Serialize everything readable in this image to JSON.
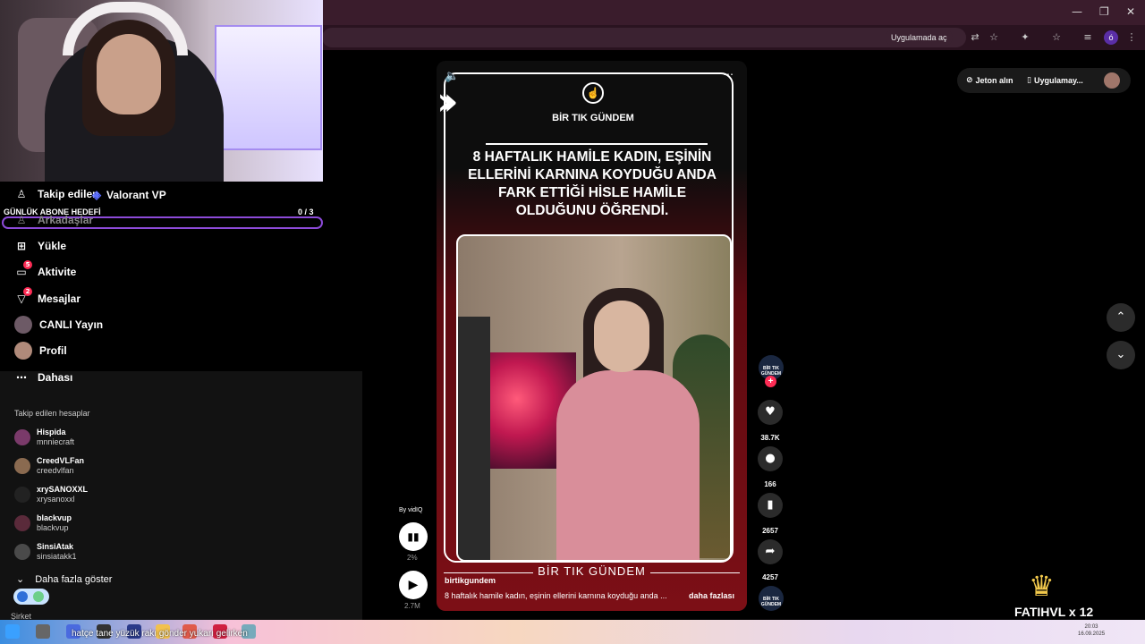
{
  "browser": {
    "open_in_app": "Uygulamada aç",
    "profile_badge": "ó",
    "window_controls": [
      "—",
      "❐",
      "✕"
    ]
  },
  "stream_overlay": {
    "goal_title": "GÜNLÜK ABONE HEDEFİ",
    "goal_count": "0 / 3",
    "game": "Valorant VP",
    "ticker": "hatçe tane yüzük rakı gönder yukarı gelirken",
    "crown_badge": "FATIHVL x 12"
  },
  "sidebar": {
    "items": [
      {
        "label": "Takip edilen",
        "icon": "person-icon"
      },
      {
        "label": "Arkadaşlar",
        "icon": "friends-icon"
      },
      {
        "label": "Yükle",
        "icon": "upload-icon"
      },
      {
        "label": "Aktivite",
        "icon": "activity-icon",
        "badge": "5"
      },
      {
        "label": "Mesajlar",
        "icon": "messages-icon",
        "badge": "2"
      },
      {
        "label": "CANLI Yayın",
        "icon": "live-icon"
      },
      {
        "label": "Profil",
        "icon": "profile-icon"
      },
      {
        "label": "Dahası",
        "icon": "more-icon"
      }
    ],
    "followed_title": "Takip edilen hesaplar",
    "followed": [
      {
        "name": "Hispida",
        "handle": "mnniecraft"
      },
      {
        "name": "CreedVLFan",
        "handle": "creedvlfan"
      },
      {
        "name": "xrySANOXXL",
        "handle": "xrysanoxxl"
      },
      {
        "name": "blackvup",
        "handle": "blackvup"
      },
      {
        "name": "SinsiAtak",
        "handle": "sinsiatakk1"
      }
    ],
    "show_more": "Daha fazla göster",
    "company": "Şirket"
  },
  "video": {
    "brand": "BİR TIK GÜNDEM",
    "headline": "8 HAFTALIK HAMİLE KADIN, EŞİNİN ELLERİNİ KARNINA KOYDUĞU ANDA FARK ETTİĞİ HİSLE HAMİLE OLDUĞUNU ÖĞRENDİ.",
    "footer_brand": "BİR TIK GÜNDEM",
    "username": "birtikgundem",
    "description": "8 haftalık hamile kadın, eşinin ellerini karnına koyduğu anda ...",
    "more": "daha fazlası"
  },
  "actions": {
    "likes": "38.7K",
    "comments": "166",
    "saves": "2657",
    "shares": "4257",
    "creator_mini": "BİR TIK GÜNDEM"
  },
  "vidiq": {
    "by": "By vidIQ",
    "pct": "2%",
    "views": "2.7M"
  },
  "header_right": {
    "coins": "Jeton alın",
    "app": "Uygulamay..."
  },
  "tray": {
    "time": "20:03",
    "date": "16.09.2025"
  }
}
